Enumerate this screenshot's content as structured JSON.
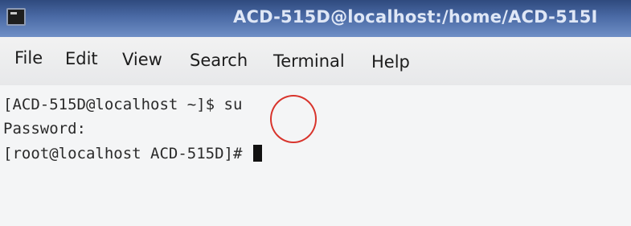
{
  "window": {
    "title": "ACD-515D@localhost:/home/ACD-515I",
    "icon": "terminal-icon"
  },
  "menu": [
    {
      "label": "File"
    },
    {
      "label": "Edit"
    },
    {
      "label": "View"
    },
    {
      "label": "Search"
    },
    {
      "label": "Terminal"
    },
    {
      "label": "Help"
    }
  ],
  "terminal": {
    "line1_prompt": "[ACD-515D@localhost ~]$ ",
    "line1_command": "su",
    "line2": "Password:",
    "line3_prompt": "[root@localhost ACD-515D]# "
  },
  "annotation": {
    "color": "#d8342c",
    "shape": "circle"
  }
}
